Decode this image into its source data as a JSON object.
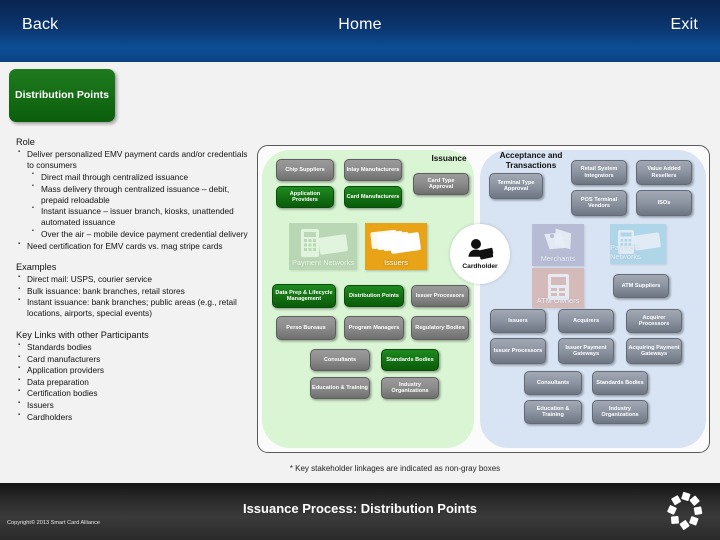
{
  "header": {
    "back_label": "Back",
    "home_label": "Home",
    "exit_label": "Exit",
    "bg_color": "#0b3670"
  },
  "tab": {
    "label": "Distribution Points",
    "color": "#177017"
  },
  "left_panel": {
    "role_heading": "Role",
    "role_items": [
      "Deliver personalized EMV payment cards and/or credentials to consumers",
      "Need certification for EMV cards vs. mag stripe cards"
    ],
    "role_subitems": [
      "Direct mail through centralized issuance",
      "Mass delivery through centralized issuance – debit, prepaid reloadable",
      "Instant issuance – issuer branch, kiosks, unattended automated issuance",
      "Over the air – mobile device payment credential delivery"
    ],
    "examples_heading": "Examples",
    "examples_items": [
      "Direct mail:  USPS, courier service",
      "Bulk issuance: bank branches, retail stores",
      "Instant issuance: bank branches; public areas (e.g., retail locations, airports, special events)"
    ],
    "key_links_heading": "Key Links with other Participants",
    "key_links_items": [
      "Standards bodies",
      "Card manufacturers",
      "Application providers",
      "Data preparation",
      "Certification bodies",
      "Issuers",
      "Cardholders"
    ]
  },
  "diagram": {
    "issuance_zone_title": "Issuance",
    "acceptance_zone_title": "Acceptance and Transactions",
    "cardholder_label": "Cardholder",
    "issuance_nodes": [
      {
        "label": "Chip Suppliers",
        "style": "gray"
      },
      {
        "label": "Inlay Manufacturers",
        "style": "gray"
      },
      {
        "label": "Card Type Approval",
        "style": "gray"
      },
      {
        "label": "Application Providers",
        "style": "green"
      },
      {
        "label": "Card Manufacturers",
        "style": "green"
      },
      {
        "label": "Data Prep & Lifecycle Management",
        "style": "green"
      },
      {
        "label": "Distribution Points",
        "style": "green"
      },
      {
        "label": "Issuer Processors",
        "style": "gray"
      },
      {
        "label": "Perso Bureaus",
        "style": "gray"
      },
      {
        "label": "Program Managers",
        "style": "gray"
      },
      {
        "label": "Regulatory Bodies",
        "style": "gray"
      },
      {
        "label": "Consultants",
        "style": "gray"
      },
      {
        "label": "Standards Bodies",
        "style": "green"
      },
      {
        "label": "Education & Training",
        "style": "gray"
      },
      {
        "label": "Industry Organizations",
        "style": "gray"
      }
    ],
    "issuance_tiles": [
      {
        "label": "Payment Networks",
        "color": "#8fae8a",
        "faded": true
      },
      {
        "label": "Issuers",
        "color": "#e8a317",
        "faded": false
      }
    ],
    "acceptance_nodes": [
      {
        "label": "Terminal Type Approval",
        "style": "blue-gray"
      },
      {
        "label": "Retail System Integrators",
        "style": "blue-gray"
      },
      {
        "label": "Value Added Resellers",
        "style": "blue-gray"
      },
      {
        "label": "POS Terminal Vendors",
        "style": "blue-gray"
      },
      {
        "label": "ISOs",
        "style": "blue-gray"
      },
      {
        "label": "ATM Suppliers",
        "style": "blue-gray"
      },
      {
        "label": "Issuers",
        "style": "blue-gray"
      },
      {
        "label": "Acquirers",
        "style": "blue-gray"
      },
      {
        "label": "Acquirer Processors",
        "style": "blue-gray"
      },
      {
        "label": "Issuer Processors",
        "style": "blue-gray"
      },
      {
        "label": "Issuer Payment Gateways",
        "style": "blue-gray"
      },
      {
        "label": "Acquiring Payment Gateways",
        "style": "blue-gray"
      },
      {
        "label": "Consultants",
        "style": "blue-gray"
      },
      {
        "label": "Standards Bodies",
        "style": "blue-gray"
      },
      {
        "label": "Education & Training",
        "style": "blue-gray"
      },
      {
        "label": "Industry Organizations",
        "style": "blue-gray"
      }
    ],
    "acceptance_tiles": [
      {
        "label": "Merchants",
        "color": "#8b86ab",
        "faded": true
      },
      {
        "label": "Payment Networks",
        "color": "#79c2dd",
        "faded": true
      },
      {
        "label": "ATM Owners",
        "color": "#d2826e",
        "faded": true
      }
    ]
  },
  "footnote": "* Key stakeholder linkages are indicated as non-gray boxes",
  "footer": {
    "title": "Issuance Process:  Distribution Points",
    "copyright": "Copyright© 2013 Smart Card Alliance"
  }
}
